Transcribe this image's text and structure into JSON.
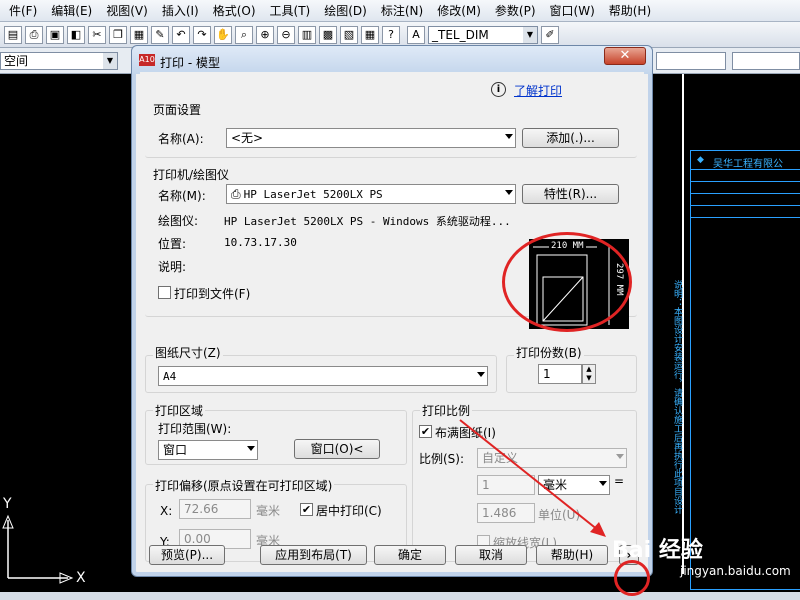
{
  "menubar": {
    "items": [
      "件(F)",
      "编辑(E)",
      "视图(V)",
      "插入(I)",
      "格式(O)",
      "工具(T)",
      "绘图(D)",
      "标注(N)",
      "修改(M)",
      "参数(P)",
      "窗口(W)",
      "帮助(H)"
    ]
  },
  "toolbar": {
    "layer_combo": "空间",
    "dimstyle_combo": "_TEL_DIM"
  },
  "drawing": {
    "company_name": "吴华工程有限公",
    "vertical_note": "说明：本图设计安装运行，请确认施工后再执行此项目设计",
    "ucs_y": "Y",
    "ucs_x": "X"
  },
  "watermark": {
    "text": "Bai 经验",
    "url": "jingyan.baidu.com"
  },
  "dialog": {
    "title": "打印 - 模型",
    "app_icon": "A10",
    "close_label": "✕",
    "help_link": "了解打印",
    "page_setup": {
      "group_title": "页面设置",
      "name_label": "名称(A):",
      "name_value": "<无>",
      "add_button": "添加(.)..."
    },
    "printer": {
      "group_title": "打印机/绘图仪",
      "name_label": "名称(M):",
      "name_value": "HP LaserJet 5200LX PS",
      "properties_button": "特性(R)...",
      "plotter_label": "绘图仪:",
      "plotter_value": "HP LaserJet 5200LX PS - Windows 系统驱动程...",
      "location_label": "位置:",
      "location_value": "10.73.17.30",
      "description_label": "说明:",
      "print_to_file_label": "打印到文件(F)",
      "paper_width_label": "210 MM",
      "paper_height_label": "297 MM"
    },
    "paper_size": {
      "group_title": "图纸尺寸(Z)",
      "value": "A4"
    },
    "copies": {
      "group_title": "打印份数(B)",
      "value": "1"
    },
    "plot_area": {
      "group_title": "打印区域",
      "range_label": "打印范围(W):",
      "range_value": "窗口",
      "window_button": "窗口(O)<"
    },
    "plot_scale": {
      "group_title": "打印比例",
      "fit_label": "布满图纸(I)",
      "fit_checked": "✔",
      "scale_label": "比例(S):",
      "scale_value": "自定义",
      "value1": "1",
      "unit_value": "毫米",
      "equals": "=",
      "value2": "1.486",
      "unit_label": "单位(U)",
      "lineweight_label": "缩放线宽(L)"
    },
    "plot_offset": {
      "group_title": "打印偏移(原点设置在可打印区域)",
      "x_label": "X:",
      "x_value": "72.66",
      "x_unit": "毫米",
      "y_label": "Y:",
      "y_value": "0.00",
      "y_unit": "毫米",
      "center_label": "居中打印(C)",
      "center_checked": "✔"
    },
    "buttons": {
      "preview": "预览(P)...",
      "apply_layout": "应用到布局(T)",
      "ok": "确定",
      "cancel": "取消",
      "help": "帮助(H)",
      "expand": "›"
    }
  }
}
